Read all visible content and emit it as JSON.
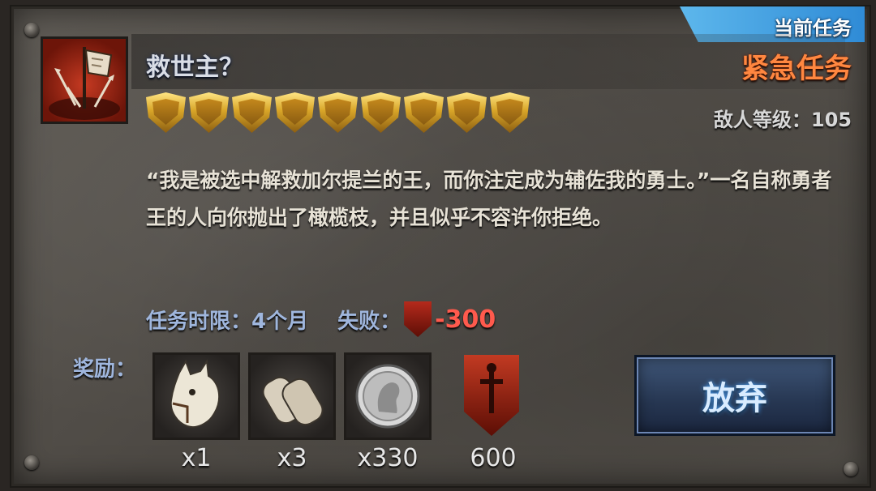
{
  "quest": {
    "title": "救世主？",
    "status_badge": "当前任务",
    "urgency": "紧急任务",
    "enemy_level_label": "敌人等级：",
    "enemy_level_value": "105",
    "difficulty_stars": 9,
    "description": "“我是被选中解救加尔提兰的王，而你注定成为辅佐我的勇士。”一名自称勇者王的人向你抛出了橄榄枝，并且似乎不容许你拒绝。",
    "time_limit_label": "任务时限：",
    "time_limit_value": "4个月",
    "fail_label": "失败：",
    "fail_value": "-300"
  },
  "rewards": {
    "label": "奖励：",
    "items": [
      {
        "icon": "horse-icon",
        "count": "x1"
      },
      {
        "icon": "scroll-icon",
        "count": "x3"
      },
      {
        "icon": "silver-coin-icon",
        "count": "x330"
      },
      {
        "icon": "reputation-crest-icon",
        "count": "600"
      }
    ]
  },
  "actions": {
    "abandon_label": "放弃"
  },
  "colors": {
    "urgent": "#ff8740",
    "badge": "#3a98de",
    "fail": "#ff5a4d",
    "label_blue": "#9fb6dd"
  }
}
